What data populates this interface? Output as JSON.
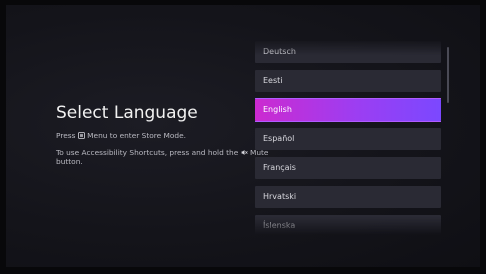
{
  "title": "Select Language",
  "store_mode_hint": {
    "before": "Press ",
    "icon": "menu-icon",
    "after": " Menu to enter Store Mode."
  },
  "accessibility_hint": {
    "before": "To use Accessibility Shortcuts, press and hold the ",
    "icon": "mute-icon",
    "after": " Mute button."
  },
  "languages": [
    "Deutsch",
    "Eesti",
    "English",
    "Español",
    "Français",
    "Hrvatski",
    "Íslenska"
  ],
  "selected_language": "English",
  "colors": {
    "background": "#14141a",
    "item": "#2a2a34",
    "selected_start": "#cc2ad0",
    "selected_end": "#7b48ff"
  }
}
